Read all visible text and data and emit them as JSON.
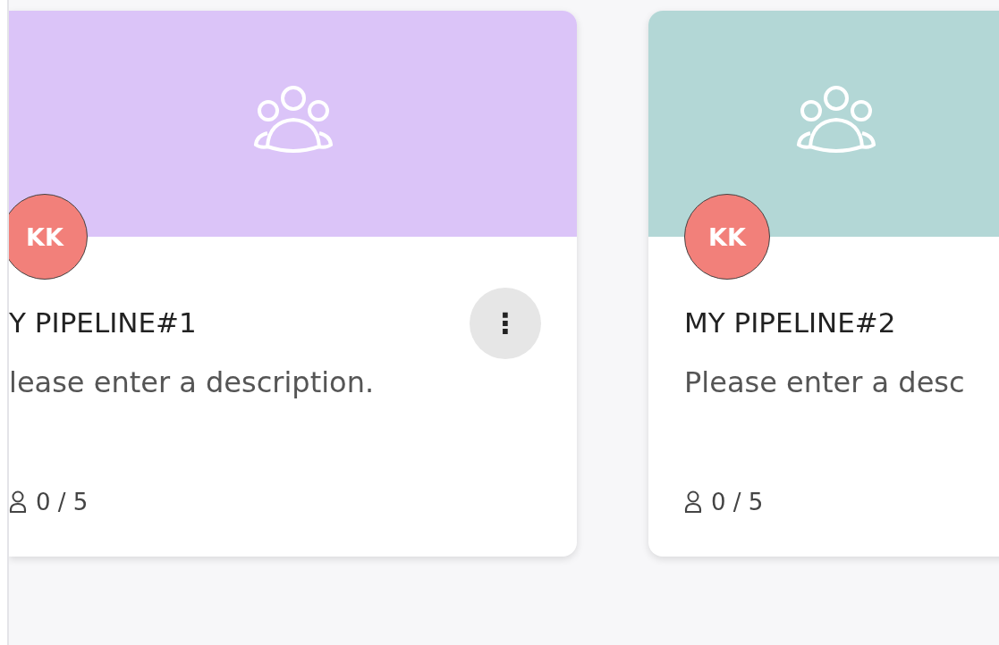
{
  "cards": [
    {
      "color": "#dbc4f8",
      "initials": "KK",
      "title": "Y PIPELINE#1",
      "description": "lease enter a description.",
      "members": "0 / 5",
      "menu_glyph": "⋮"
    },
    {
      "color": "#b3d7d6",
      "initials": "KK",
      "title": "MY PIPELINE#2",
      "description": "Please enter a desc",
      "members": "0 / 5"
    }
  ]
}
